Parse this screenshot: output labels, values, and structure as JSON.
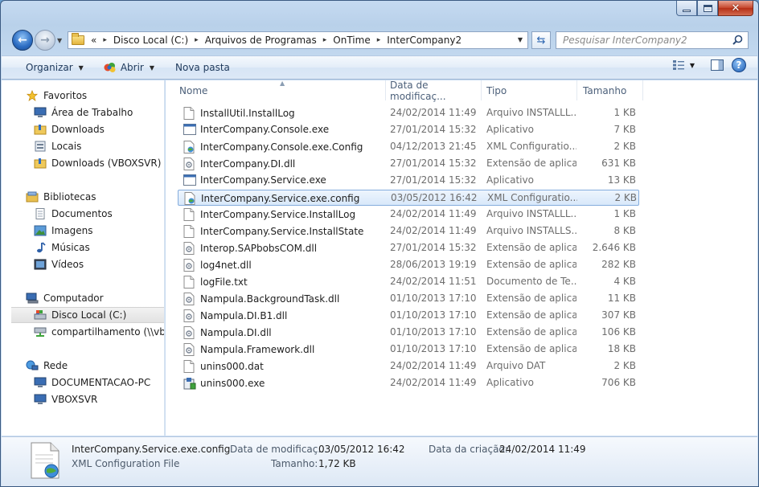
{
  "window": {
    "caption_min": "minimize",
    "caption_max": "maximize",
    "caption_close": "✕"
  },
  "address": {
    "overflow": "«",
    "crumbs": [
      "Disco Local (C:)",
      "Arquivos de Programas",
      "OnTime",
      "InterCompany2"
    ]
  },
  "search": {
    "placeholder": "Pesquisar InterCompany2"
  },
  "toolbar": {
    "organizar": "Organizar",
    "abrir": "Abrir",
    "nova_pasta": "Nova pasta"
  },
  "nav": {
    "favorites_header": "Favoritos",
    "favorites": [
      "Área de Trabalho",
      "Downloads",
      "Locais",
      "Downloads (VBOXSVR)"
    ],
    "libraries_header": "Bibliotecas",
    "libraries": [
      "Documentos",
      "Imagens",
      "Músicas",
      "Vídeos"
    ],
    "computer_header": "Computador",
    "computer": [
      "Disco Local (C:)",
      "compartilhamento (\\\\vbox"
    ],
    "network_header": "Rede",
    "network": [
      "DOCUMENTACAO-PC",
      "VBOXSVR"
    ]
  },
  "columns": {
    "name": "Nome",
    "date": "Data de modificaç...",
    "type": "Tipo",
    "size": "Tamanho"
  },
  "files": [
    {
      "name": "InstallUtil.InstallLog",
      "date": "24/02/2014 11:49",
      "type": "Arquivo INSTALLL...",
      "size": "1 KB",
      "icon": "text-file-icon"
    },
    {
      "name": "InterCompany.Console.exe",
      "date": "27/01/2014 15:32",
      "type": "Aplicativo",
      "size": "7 KB",
      "icon": "exe-file-icon"
    },
    {
      "name": "InterCompany.Console.exe.Config",
      "date": "04/12/2013 21:45",
      "type": "XML Configuratio...",
      "size": "2 KB",
      "icon": "xml-file-icon"
    },
    {
      "name": "InterCompany.DI.dll",
      "date": "27/01/2014 15:32",
      "type": "Extensão de aplica...",
      "size": "631 KB",
      "icon": "dll-file-icon"
    },
    {
      "name": "InterCompany.Service.exe",
      "date": "27/01/2014 15:32",
      "type": "Aplicativo",
      "size": "13 KB",
      "icon": "exe-file-icon"
    },
    {
      "name": "InterCompany.Service.exe.config",
      "date": "03/05/2012 16:42",
      "type": "XML Configuratio...",
      "size": "2 KB",
      "icon": "xml-file-icon",
      "selected": true
    },
    {
      "name": "InterCompany.Service.InstallLog",
      "date": "24/02/2014 11:49",
      "type": "Arquivo INSTALLL...",
      "size": "1 KB",
      "icon": "text-file-icon"
    },
    {
      "name": "InterCompany.Service.InstallState",
      "date": "24/02/2014 11:49",
      "type": "Arquivo INSTALLS...",
      "size": "8 KB",
      "icon": "text-file-icon"
    },
    {
      "name": "Interop.SAPbobsCOM.dll",
      "date": "27/01/2014 15:32",
      "type": "Extensão de aplica...",
      "size": "2.646 KB",
      "icon": "dll-file-icon"
    },
    {
      "name": "log4net.dll",
      "date": "28/06/2013 19:19",
      "type": "Extensão de aplica...",
      "size": "282 KB",
      "icon": "dll-file-icon"
    },
    {
      "name": "logFile.txt",
      "date": "24/02/2014 11:51",
      "type": "Documento de Te...",
      "size": "4 KB",
      "icon": "text-file-icon"
    },
    {
      "name": "Nampula.BackgroundTask.dll",
      "date": "01/10/2013 17:10",
      "type": "Extensão de aplica...",
      "size": "11 KB",
      "icon": "dll-file-icon"
    },
    {
      "name": "Nampula.DI.B1.dll",
      "date": "01/10/2013 17:10",
      "type": "Extensão de aplica...",
      "size": "307 KB",
      "icon": "dll-file-icon"
    },
    {
      "name": "Nampula.DI.dll",
      "date": "01/10/2013 17:10",
      "type": "Extensão de aplica...",
      "size": "106 KB",
      "icon": "dll-file-icon"
    },
    {
      "name": "Nampula.Framework.dll",
      "date": "01/10/2013 17:10",
      "type": "Extensão de aplica...",
      "size": "18 KB",
      "icon": "dll-file-icon"
    },
    {
      "name": "unins000.dat",
      "date": "24/02/2014 11:49",
      "type": "Arquivo DAT",
      "size": "2 KB",
      "icon": "text-file-icon"
    },
    {
      "name": "unins000.exe",
      "date": "24/02/2014 11:49",
      "type": "Aplicativo",
      "size": "706 KB",
      "icon": "installer-icon"
    }
  ],
  "details": {
    "file_name": "InterCompany.Service.exe.config",
    "file_type": "XML Configuration File",
    "modified_label": "Data de modificaç...",
    "modified_value": "03/05/2012 16:42",
    "size_label": "Tamanho:",
    "size_value": "1,72 KB",
    "created_label": "Data da criação:",
    "created_value": "24/02/2014 11:49"
  }
}
